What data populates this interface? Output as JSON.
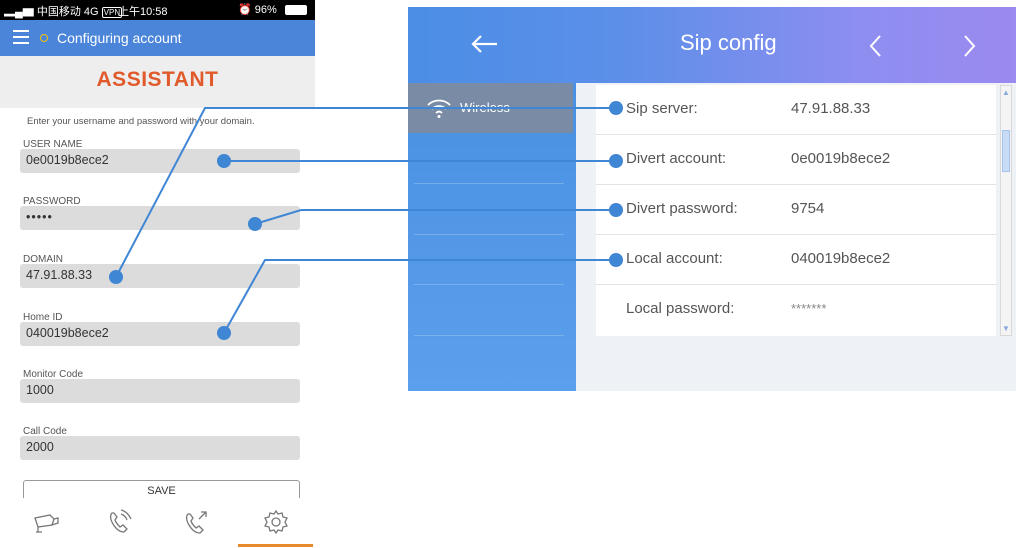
{
  "phone": {
    "status_bar": {
      "carrier": "中国移动",
      "network": "4G",
      "vpn": "VPN",
      "time": "上午10:58",
      "battery": "96%"
    },
    "title_bar": {
      "status_text": "Configuring account",
      "status_dot_color": "#f1c40f"
    },
    "heading": "ASSISTANT",
    "heading_color": "#e05a2b",
    "hint": "Enter your username and password with your domain.",
    "fields": {
      "username": {
        "label": "USER NAME",
        "value": "0e0019b8ece2"
      },
      "password": {
        "label": "PASSWORD",
        "value": "•••••"
      },
      "domain": {
        "label": "DOMAIN",
        "value": "47.91.88.33"
      },
      "home_id": {
        "label": "Home ID",
        "value": "040019b8ece2"
      },
      "monitor_code": {
        "label": "Monitor Code",
        "value": "1000"
      },
      "call_code": {
        "label": "Call Code",
        "value": "2000"
      }
    },
    "save_label": "SAVE",
    "tabs": [
      {
        "icon": "camera-icon"
      },
      {
        "icon": "phone-call-icon"
      },
      {
        "icon": "call-transfer-icon"
      },
      {
        "icon": "gear-icon",
        "active": true
      }
    ],
    "accent_color": "#4a85d9"
  },
  "tablet": {
    "header": {
      "title": "Sip config",
      "back_icon": "back-arrow-icon",
      "prev_icon": "chevron-left-icon",
      "next_icon": "chevron-right-icon"
    },
    "sidebar": {
      "items": [
        {
          "label": "Wireless",
          "icon": "wifi-icon",
          "selected": true
        }
      ]
    },
    "settings": [
      {
        "label": "Sip server:",
        "value": "47.91.88.33"
      },
      {
        "label": "Divert account:",
        "value": "0e0019b8ece2"
      },
      {
        "label": "Divert password:",
        "value": "9754"
      },
      {
        "label": "Local account:",
        "value": "040019b8ece2"
      },
      {
        "label": "Local password:",
        "value": "*******"
      }
    ]
  },
  "connector_color": "#3f86d4"
}
